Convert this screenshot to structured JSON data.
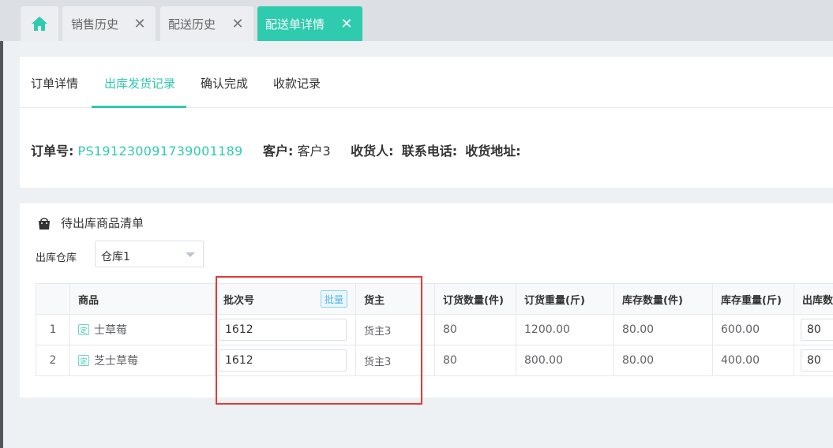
{
  "tabs": {
    "home_icon": "home-icon",
    "items": [
      {
        "label": "销售历史",
        "active": false
      },
      {
        "label": "配送历史",
        "active": false
      },
      {
        "label": "配送单详情",
        "active": true
      }
    ],
    "close_glyph": "✕"
  },
  "subtabs": [
    {
      "label": "订单详情"
    },
    {
      "label": "出库发货记录"
    },
    {
      "label": "确认完成"
    },
    {
      "label": "收款记录"
    }
  ],
  "order": {
    "order_no_label": "订单号:",
    "order_no": "PS191230091739001189",
    "customer_label": "客户:",
    "customer": "客户3",
    "receiver_label": "收货人:",
    "phone_label": "联系电话:",
    "address_label": "收货地址:"
  },
  "section": {
    "title": "待出库商品清单",
    "icon": "shopping-bag-icon"
  },
  "warehouse": {
    "label": "出库仓库",
    "value": "仓库1"
  },
  "table": {
    "headers": [
      "",
      "商品",
      "批次号",
      "货主",
      "订货数量(件)",
      "订货重量(斤)",
      "库存数量(件)",
      "库存重量(斤)",
      "出库数"
    ],
    "batch_button": "批量",
    "rows": [
      {
        "index": "1",
        "badge": "定",
        "product": "士草莓",
        "batch": "1612",
        "owner": "货主3",
        "order_qty": "80",
        "order_weight": "1200.00",
        "stock_qty": "80.00",
        "stock_weight": "600.00",
        "out_qty": "80"
      },
      {
        "index": "2",
        "badge": "定",
        "product": "芝士草莓",
        "batch": "1612",
        "owner": "货主3",
        "order_qty": "80",
        "order_weight": "800.00",
        "stock_qty": "80.00",
        "stock_weight": "400.00",
        "out_qty": "80"
      }
    ]
  },
  "colors": {
    "accent": "#2fcbaf",
    "highlight": "#e53935"
  }
}
